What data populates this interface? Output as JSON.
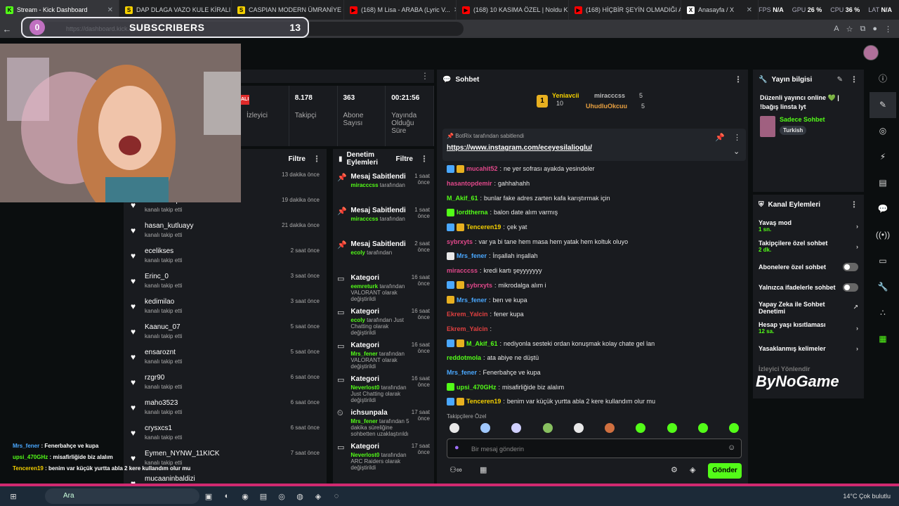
{
  "browser": {
    "tabs": [
      {
        "label": "Stream - Kick Dashboard",
        "color": "#53fc18",
        "glyph": "K",
        "active": true
      },
      {
        "label": "DAP DLAGA VAZO KULE KİRALIK E...",
        "color": "#f5d000",
        "glyph": "S"
      },
      {
        "label": "CASPIAN MODERN ÜMRANİYE Ö...",
        "color": "#f5d000",
        "glyph": "S"
      },
      {
        "label": "(168) M Lisa - ARABA (Lyric V...",
        "color": "#ff0000",
        "glyph": "▶"
      },
      {
        "label": "(168) 10 KASIMA ÖZEL | Noldu K...",
        "color": "#ff0000",
        "glyph": "▶"
      },
      {
        "label": "(168) HİÇBİR ŞEYİN OLMADIĞI AD...",
        "color": "#ff0000",
        "glyph": "▶"
      },
      {
        "label": "Anasayfa / X",
        "color": "#ffffff",
        "glyph": "X"
      }
    ],
    "perf": [
      {
        "k": "FPS",
        "v": "N/A"
      },
      {
        "k": "GPU",
        "v": "26 %"
      },
      {
        "k": "CPU",
        "v": "36 %"
      },
      {
        "k": "LAT",
        "v": "N/A"
      }
    ],
    "url": "https://dashboard.kick.com/"
  },
  "overlay": {
    "count_left": "0",
    "label": "SUBSCRIBERS",
    "count_right": "13"
  },
  "stats": [
    {
      "v": "-",
      "l": "İzleyici"
    },
    {
      "v": "8.178",
      "l": "Takipçi"
    },
    {
      "v": "363",
      "l": "Abone Sayısı"
    },
    {
      "v": "00:21:56",
      "l": "Yayında Olduğu Süre"
    }
  ],
  "stats_badge": "ALI",
  "follows": {
    "filter": "Filtre",
    "rows": [
      {
        "name": "",
        "sub": "",
        "time": "13 dakika önce"
      },
      {
        "name": "KerimEfeq",
        "sub": "kanalı takip etti",
        "time": "19 dakika önce"
      },
      {
        "name": "hasan_kutluayy",
        "sub": "kanalı takip etti",
        "time": "21 dakika önce"
      },
      {
        "name": "ecelikses",
        "sub": "kanalı takip etti",
        "time": "2 saat önce"
      },
      {
        "name": "Erinc_0",
        "sub": "kanalı takip etti",
        "time": "3 saat önce"
      },
      {
        "name": "kedimilao",
        "sub": "kanalı takip etti",
        "time": "3 saat önce"
      },
      {
        "name": "Kaanuc_07",
        "sub": "kanalı takip etti",
        "time": "5 saat önce"
      },
      {
        "name": "ensaroznt",
        "sub": "kanalı takip etti",
        "time": "5 saat önce"
      },
      {
        "name": "rzgr90",
        "sub": "kanalı takip etti",
        "time": "6 saat önce"
      },
      {
        "name": "maho3523",
        "sub": "kanalı takip etti",
        "time": "6 saat önce"
      },
      {
        "name": "crysxcs1",
        "sub": "kanalı takip etti",
        "time": "6 saat önce"
      },
      {
        "name": "Eymen_NYNW_11KICK",
        "sub": "kanalı takip etti",
        "time": "7 saat önce"
      },
      {
        "name": "mucaaninbaldizi",
        "sub": "",
        "time": ""
      }
    ]
  },
  "modact": {
    "title": "Denetim Eylemleri",
    "filter": "Filtre",
    "rows": [
      {
        "icon": "pin-icon",
        "title": "Mesaj Sabitlendi",
        "user": "miracccss",
        "desc": "tarafından",
        "time": "1 saat önce"
      },
      {
        "icon": "pin-icon",
        "title": "Mesaj Sabitlendi",
        "user": "miracccss",
        "desc": "tarafından",
        "time": "1 saat önce"
      },
      {
        "icon": "pin-icon",
        "title": "Mesaj Sabitlendi",
        "user": "ecoly",
        "desc": "tarafından",
        "time": "2 saat önce"
      },
      {
        "icon": "category-icon",
        "title": "Kategori",
        "user": "eemreturk",
        "desc": "tarafından VALORANT olarak değiştirildi",
        "time": "16 saat önce"
      },
      {
        "icon": "category-icon",
        "title": "Kategori",
        "user": "ecoly",
        "desc": "tarafından Just Chatting olarak değiştirildi",
        "time": "16 saat önce"
      },
      {
        "icon": "category-icon",
        "title": "Kategori",
        "user": "Mrs_fener",
        "desc": "tarafından VALORANT olarak değiştirildi",
        "time": "16 saat önce"
      },
      {
        "icon": "category-icon",
        "title": "Kategori",
        "user": "Neverlost0",
        "desc": "tarafından Just Chatting olarak değiştirildi",
        "time": "16 saat önce"
      },
      {
        "icon": "timeout-icon",
        "title": "ichsunpala",
        "user": "Mrs_fener",
        "desc": "tarafından 5 dakika süreliğine sohbetten uzaklaştırıldı",
        "time": "17 saat önce"
      },
      {
        "icon": "category-icon",
        "title": "Kategori",
        "user": "Neverlost0",
        "desc": "tarafından ARC Raiders olarak değiştirildi",
        "time": "17 saat önce"
      }
    ]
  },
  "chat": {
    "title": "Sohbet",
    "top": [
      {
        "name": "Yeniavcii",
        "val": "10"
      },
      {
        "name": "miracccss",
        "val": "5"
      },
      {
        "name": "UhudluOkcuu",
        "val": "5"
      }
    ],
    "top_rank": "1",
    "pinned_by": "BotRix tarafından sabitlendi",
    "pinned_link": "https://www.instagram.com/eceyesilalioglu/",
    "messages": [
      {
        "user": "mucahit52",
        "color": "#e0488a",
        "text": "ne yer sofrası ayakda yesindeler"
      },
      {
        "user": "hasantopdemir",
        "color": "#e0488a",
        "text": "gahhahahh"
      },
      {
        "user": "M_Akif_61",
        "color": "#53fc18",
        "text": "bunlar fake adres zarten kafa karıştırmak için"
      },
      {
        "user": "lordtherna",
        "color": "#53fc18",
        "text": "balon date alım varmış"
      },
      {
        "user": "Tenceren19",
        "color": "#f5d000",
        "text": "çek yat"
      },
      {
        "user": "sybrxyts",
        "color": "#e0488a",
        "text": "var ya bi tane hem masa hem yatak hem koltuk oluyo"
      },
      {
        "user": "Mrs_fener",
        "color": "#4aa8ff",
        "text": "İnşallah inşallah"
      },
      {
        "user": "miracccss",
        "color": "#e0488a",
        "text": "kredi kartı şeyyyyyyy"
      },
      {
        "user": "sybrxyts",
        "color": "#e0488a",
        "text": "mikrodalga alım i"
      },
      {
        "user": "Mrs_fener",
        "color": "#4aa8ff",
        "text": "ben ve kupa"
      },
      {
        "user": "Ekrem_Yalcin",
        "color": "#e04040",
        "text": "fener kupa"
      },
      {
        "user": "Ekrem_Yalcin",
        "color": "#e04040",
        "text": ""
      },
      {
        "user": "M_Akif_61",
        "color": "#53fc18",
        "text": "nediyonla sesteki ordan konuşmak kolay chate gel lan"
      },
      {
        "user": "reddotmola",
        "color": "#53fc18",
        "text": "ata abiye ne düştü"
      },
      {
        "user": "Mrs_fener",
        "color": "#4aa8ff",
        "text": "Fenerbahçe ve kupa"
      },
      {
        "user": "upsi_470GHz",
        "color": "#53fc18",
        "text": "misafirliğide biz alalım"
      },
      {
        "user": "Tenceren19",
        "color": "#f5d000",
        "text": "benim var küçük yurtta abla 2 kere kullandım olur mu"
      }
    ],
    "emote_label": "Takipçilere Özel",
    "input_placeholder": "Bir mesaj gönderin",
    "send": "Gönder"
  },
  "streaminfo": {
    "title": "Yayın bilgisi",
    "desc": "Düzenli yayıncı online 💚 | !bağış linsta lyt",
    "category": "Sadece Sohbet",
    "lang": "Turkish"
  },
  "chanact": {
    "title": "Kanal Eylemleri",
    "rows": [
      {
        "label": "Yavaş mod",
        "sub": "1 sn.",
        "ctl": "chev"
      },
      {
        "label": "Takipçilere özel sohbet",
        "sub": "2 dk.",
        "ctl": "chev"
      },
      {
        "label": "Abonelere özel sohbet",
        "sub": "",
        "ctl": "toggle"
      },
      {
        "label": "Yalnızca ifadelerle sohbet",
        "sub": "",
        "ctl": "toggle"
      },
      {
        "label": "Yapay Zeka ile Sohbet Denetimi",
        "sub": "",
        "ctl": "ext"
      },
      {
        "label": "Hesap yaşı kısıtlaması",
        "sub": "12 sa.",
        "ctl": "chev"
      },
      {
        "label": "Yasaklanmış kelimeler",
        "sub": "",
        "ctl": "chev"
      },
      {
        "label": "İzleyici Yönlendir",
        "sub": "",
        "ctl": ""
      }
    ]
  },
  "overlay_chat": [
    {
      "user": "Mrs_fener",
      "color": "#4aa8ff",
      "text": "Fenerbahçe ve kupa"
    },
    {
      "user": "upsi_470GHz",
      "color": "#53fc18",
      "text": "misafirliğide biz alalım"
    },
    {
      "user": "Tenceren19",
      "color": "#f5d000",
      "text": "benim var küçük yurtta abla 2 kere kullandım olur mu"
    }
  ],
  "bynogame": "ByNoGame",
  "taskbar": {
    "search": "Ara",
    "weather": "14°C  Çok bulutlu"
  }
}
